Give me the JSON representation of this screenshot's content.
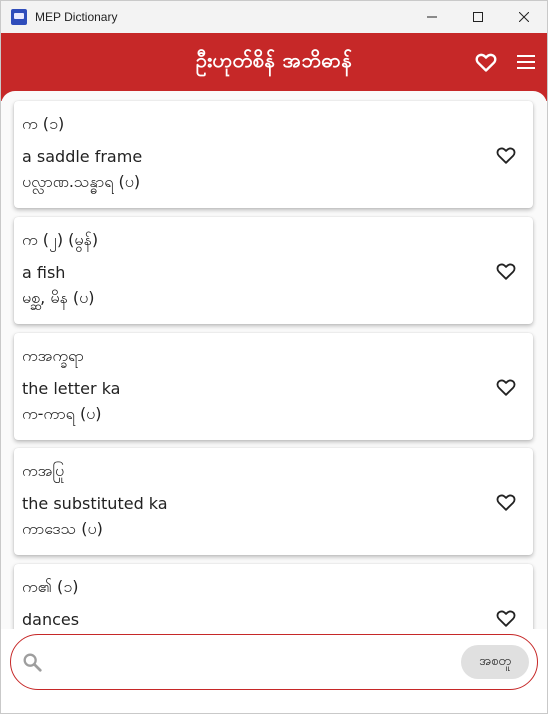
{
  "window": {
    "title": "MEP Dictionary"
  },
  "header": {
    "title": "ဦးဟုတ်စိန် အဘိဓာန်"
  },
  "entries": [
    {
      "word": "က (၁)",
      "definition": "a saddle frame",
      "pos": "ပလ္လာဏ.သန္ဓာရ (ပ)"
    },
    {
      "word": "က (၂) (မွန်)",
      "definition": "a fish",
      "pos": "မစ္ဆ, မိန (ပ)"
    },
    {
      "word": "ကအက္ခရာ",
      "definition": "the letter ka",
      "pos": "က-ကာရ (ပ)"
    },
    {
      "word": "ကအပြု",
      "definition": "the substituted ka",
      "pos": "ကာဒေသ (ပ)"
    },
    {
      "word": "က၏ (၁)",
      "definition": "dances",
      "pos": ""
    }
  ],
  "search": {
    "placeholder": "",
    "value": "",
    "button_label": "အစတူ"
  },
  "colors": {
    "accent": "#c62828"
  },
  "icons": {
    "favorite": "heart-outline-icon",
    "menu": "hamburger-menu-icon",
    "search": "search-icon"
  }
}
